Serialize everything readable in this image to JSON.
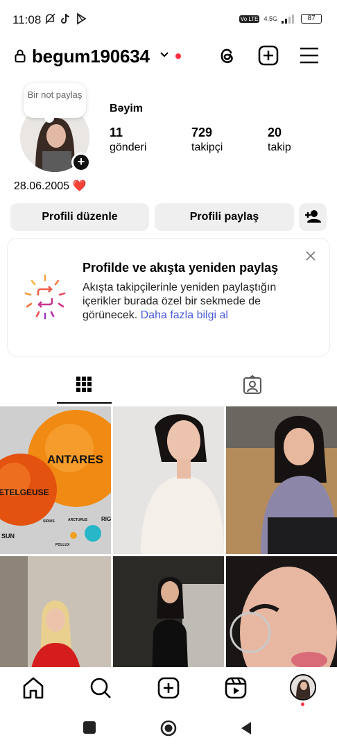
{
  "status": {
    "time": "11:08",
    "network": "4.5G",
    "volte": "Vo LTE",
    "battery": "87"
  },
  "header": {
    "username": "begum190634",
    "icons": [
      "lock-icon",
      "chevron-down-icon",
      "threads-icon",
      "create-icon",
      "menu-icon"
    ]
  },
  "profile": {
    "note": "Bir not paylaş",
    "display_name": "Bəyim",
    "stats": [
      {
        "value": "11",
        "label": "gönderi"
      },
      {
        "value": "729",
        "label": "takipçi"
      },
      {
        "value": "20",
        "label": "takip"
      }
    ],
    "bio": "28.06.2005 ❤️"
  },
  "actions": {
    "edit_profile": "Profili düzenle",
    "share_profile": "Profili paylaş"
  },
  "card": {
    "title": "Profilde ve akışta yeniden paylaş",
    "body": "Akışta takipçilerinle yeniden paylaştığın içerikler burada özel bir sekmede de görünecek.",
    "link": "Daha fazla bilgi al"
  },
  "tabs": [
    "grid-icon",
    "tagged-icon"
  ],
  "grid": {
    "post1_labels": [
      "ANTARES",
      "ETELGEUSE",
      "SUN",
      "SIRIUS",
      "POLLUX",
      "ARCTURUS",
      "RIG"
    ]
  },
  "colors": {
    "accent_link": "#4a5bd9",
    "notification": "#ff3040",
    "button_bg": "#efefef"
  }
}
